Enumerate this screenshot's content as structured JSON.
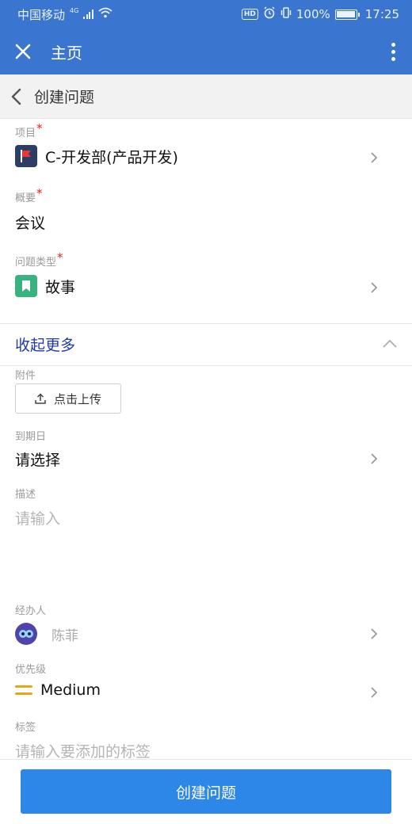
{
  "status_bar": {
    "carrier": "中国移动",
    "network": "4G",
    "battery": "100%",
    "time": "17:25",
    "hd_badge": "HD"
  },
  "app_bar": {
    "title": "主页",
    "close_icon": "close-icon",
    "more_icon": "more-vertical-icon"
  },
  "sub_bar": {
    "title": "创建问题",
    "back_icon": "chevron-left-icon"
  },
  "form": {
    "project": {
      "label": "项目",
      "required": "*",
      "value": "C-开发部(产品开发)",
      "icon": "flag-icon"
    },
    "summary": {
      "label": "概要",
      "required": "*",
      "value": "会议"
    },
    "issue_type": {
      "label": "问题类型",
      "required": "*",
      "value": "故事",
      "icon": "bookmark-icon"
    },
    "collapse_toggle": {
      "label": "收起更多",
      "icon": "chevron-up-icon"
    },
    "attachment": {
      "label": "附件",
      "button": "点击上传",
      "icon": "upload-icon"
    },
    "due_date": {
      "label": "到期日",
      "value": "请选择"
    },
    "description": {
      "label": "描述",
      "placeholder": "请输入"
    },
    "assignee": {
      "label": "经办人",
      "value": "陈菲",
      "icon": "avatar-icon"
    },
    "priority": {
      "label": "优先级",
      "value": "Medium",
      "icon": "priority-medium-icon",
      "color": "#e8a516"
    },
    "labels": {
      "label": "标签",
      "placeholder": "请输入要添加的标签"
    }
  },
  "footer": {
    "submit_label": "创建问题"
  },
  "colors": {
    "header": "#3a76d0",
    "primary_button": "#2c87e8",
    "link": "#1e3aa8",
    "required": "#e02020"
  }
}
